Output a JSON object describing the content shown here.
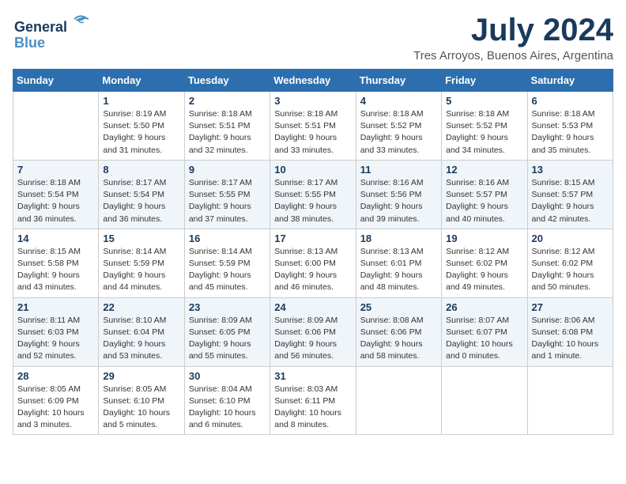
{
  "logo": {
    "line1": "General",
    "line2": "Blue"
  },
  "header": {
    "month": "July 2024",
    "location": "Tres Arroyos, Buenos Aires, Argentina"
  },
  "days_of_week": [
    "Sunday",
    "Monday",
    "Tuesday",
    "Wednesday",
    "Thursday",
    "Friday",
    "Saturday"
  ],
  "weeks": [
    [
      {
        "day": "",
        "info": ""
      },
      {
        "day": "1",
        "info": "Sunrise: 8:19 AM\nSunset: 5:50 PM\nDaylight: 9 hours\nand 31 minutes."
      },
      {
        "day": "2",
        "info": "Sunrise: 8:18 AM\nSunset: 5:51 PM\nDaylight: 9 hours\nand 32 minutes."
      },
      {
        "day": "3",
        "info": "Sunrise: 8:18 AM\nSunset: 5:51 PM\nDaylight: 9 hours\nand 33 minutes."
      },
      {
        "day": "4",
        "info": "Sunrise: 8:18 AM\nSunset: 5:52 PM\nDaylight: 9 hours\nand 33 minutes."
      },
      {
        "day": "5",
        "info": "Sunrise: 8:18 AM\nSunset: 5:52 PM\nDaylight: 9 hours\nand 34 minutes."
      },
      {
        "day": "6",
        "info": "Sunrise: 8:18 AM\nSunset: 5:53 PM\nDaylight: 9 hours\nand 35 minutes."
      }
    ],
    [
      {
        "day": "7",
        "info": "Sunrise: 8:18 AM\nSunset: 5:54 PM\nDaylight: 9 hours\nand 36 minutes."
      },
      {
        "day": "8",
        "info": "Sunrise: 8:17 AM\nSunset: 5:54 PM\nDaylight: 9 hours\nand 36 minutes."
      },
      {
        "day": "9",
        "info": "Sunrise: 8:17 AM\nSunset: 5:55 PM\nDaylight: 9 hours\nand 37 minutes."
      },
      {
        "day": "10",
        "info": "Sunrise: 8:17 AM\nSunset: 5:55 PM\nDaylight: 9 hours\nand 38 minutes."
      },
      {
        "day": "11",
        "info": "Sunrise: 8:16 AM\nSunset: 5:56 PM\nDaylight: 9 hours\nand 39 minutes."
      },
      {
        "day": "12",
        "info": "Sunrise: 8:16 AM\nSunset: 5:57 PM\nDaylight: 9 hours\nand 40 minutes."
      },
      {
        "day": "13",
        "info": "Sunrise: 8:15 AM\nSunset: 5:57 PM\nDaylight: 9 hours\nand 42 minutes."
      }
    ],
    [
      {
        "day": "14",
        "info": "Sunrise: 8:15 AM\nSunset: 5:58 PM\nDaylight: 9 hours\nand 43 minutes."
      },
      {
        "day": "15",
        "info": "Sunrise: 8:14 AM\nSunset: 5:59 PM\nDaylight: 9 hours\nand 44 minutes."
      },
      {
        "day": "16",
        "info": "Sunrise: 8:14 AM\nSunset: 5:59 PM\nDaylight: 9 hours\nand 45 minutes."
      },
      {
        "day": "17",
        "info": "Sunrise: 8:13 AM\nSunset: 6:00 PM\nDaylight: 9 hours\nand 46 minutes."
      },
      {
        "day": "18",
        "info": "Sunrise: 8:13 AM\nSunset: 6:01 PM\nDaylight: 9 hours\nand 48 minutes."
      },
      {
        "day": "19",
        "info": "Sunrise: 8:12 AM\nSunset: 6:02 PM\nDaylight: 9 hours\nand 49 minutes."
      },
      {
        "day": "20",
        "info": "Sunrise: 8:12 AM\nSunset: 6:02 PM\nDaylight: 9 hours\nand 50 minutes."
      }
    ],
    [
      {
        "day": "21",
        "info": "Sunrise: 8:11 AM\nSunset: 6:03 PM\nDaylight: 9 hours\nand 52 minutes."
      },
      {
        "day": "22",
        "info": "Sunrise: 8:10 AM\nSunset: 6:04 PM\nDaylight: 9 hours\nand 53 minutes."
      },
      {
        "day": "23",
        "info": "Sunrise: 8:09 AM\nSunset: 6:05 PM\nDaylight: 9 hours\nand 55 minutes."
      },
      {
        "day": "24",
        "info": "Sunrise: 8:09 AM\nSunset: 6:06 PM\nDaylight: 9 hours\nand 56 minutes."
      },
      {
        "day": "25",
        "info": "Sunrise: 8:08 AM\nSunset: 6:06 PM\nDaylight: 9 hours\nand 58 minutes."
      },
      {
        "day": "26",
        "info": "Sunrise: 8:07 AM\nSunset: 6:07 PM\nDaylight: 10 hours\nand 0 minutes."
      },
      {
        "day": "27",
        "info": "Sunrise: 8:06 AM\nSunset: 6:08 PM\nDaylight: 10 hours\nand 1 minute."
      }
    ],
    [
      {
        "day": "28",
        "info": "Sunrise: 8:05 AM\nSunset: 6:09 PM\nDaylight: 10 hours\nand 3 minutes."
      },
      {
        "day": "29",
        "info": "Sunrise: 8:05 AM\nSunset: 6:10 PM\nDaylight: 10 hours\nand 5 minutes."
      },
      {
        "day": "30",
        "info": "Sunrise: 8:04 AM\nSunset: 6:10 PM\nDaylight: 10 hours\nand 6 minutes."
      },
      {
        "day": "31",
        "info": "Sunrise: 8:03 AM\nSunset: 6:11 PM\nDaylight: 10 hours\nand 8 minutes."
      },
      {
        "day": "",
        "info": ""
      },
      {
        "day": "",
        "info": ""
      },
      {
        "day": "",
        "info": ""
      }
    ]
  ]
}
